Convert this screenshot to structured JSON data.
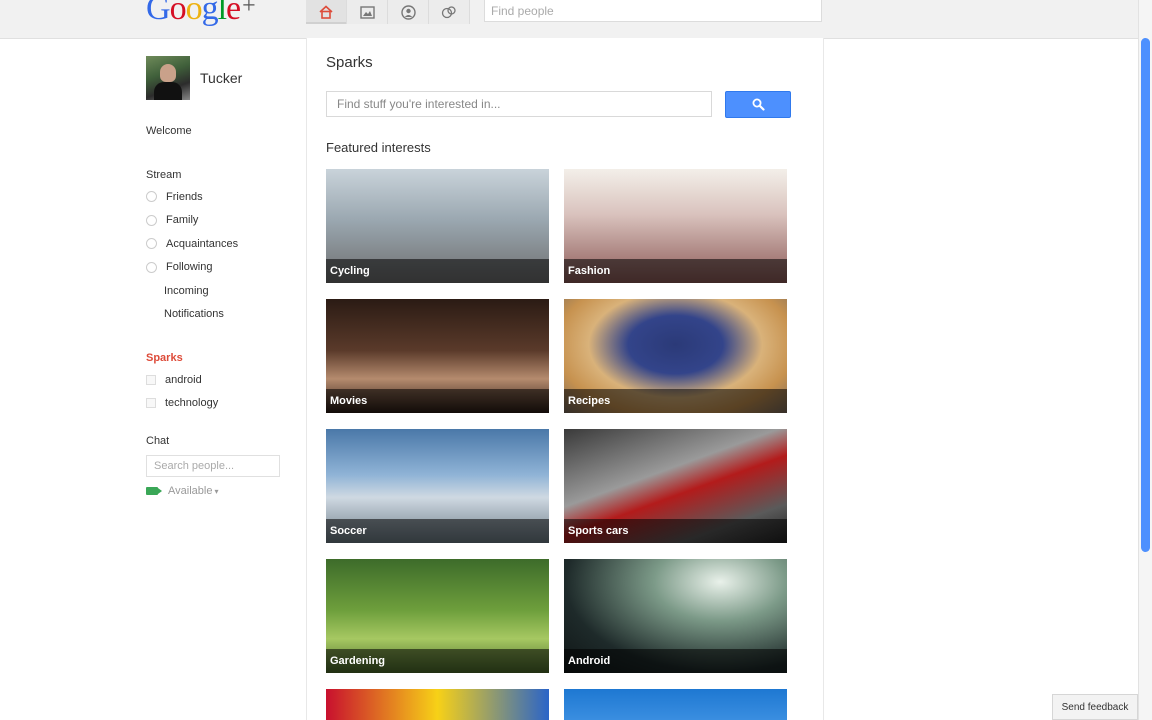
{
  "header": {
    "logo_letters": [
      {
        "ch": "G",
        "color": "#3369e8"
      },
      {
        "ch": "o",
        "color": "#d50f25"
      },
      {
        "ch": "o",
        "color": "#eeb211"
      },
      {
        "ch": "g",
        "color": "#3369e8"
      },
      {
        "ch": "l",
        "color": "#009925"
      },
      {
        "ch": "e",
        "color": "#d50f25"
      },
      {
        "ch": "+",
        "color": "#555555"
      }
    ],
    "nav": [
      {
        "icon": "home-icon",
        "active": true
      },
      {
        "icon": "photos-icon",
        "active": false
      },
      {
        "icon": "profile-icon",
        "active": false
      },
      {
        "icon": "circles-icon",
        "active": false
      }
    ],
    "find_people_placeholder": "Find people"
  },
  "sidebar": {
    "profile_name": "Tucker",
    "welcome": "Welcome",
    "stream_title": "Stream",
    "stream_items": [
      "Friends",
      "Family",
      "Acquaintances",
      "Following"
    ],
    "stream_subitems": [
      "Incoming",
      "Notifications"
    ],
    "sparks_title": "Sparks",
    "sparks_items": [
      "android",
      "technology"
    ],
    "chat_title": "Chat",
    "chat_search_placeholder": "Search people...",
    "chat_status": "Available",
    "chat_status_caret": "▾"
  },
  "main": {
    "title": "Sparks",
    "search_placeholder": "Find stuff you're interested in...",
    "featured_title": "Featured interests",
    "interests": [
      "Cycling",
      "Fashion",
      "Movies",
      "Recipes",
      "Soccer",
      "Sports cars",
      "Gardening",
      "Android",
      "",
      ""
    ]
  },
  "footer": {
    "send_feedback": "Send feedback"
  },
  "colors": {
    "accent_blue": "#4d90fe",
    "sparks_red": "#dd4b39"
  }
}
